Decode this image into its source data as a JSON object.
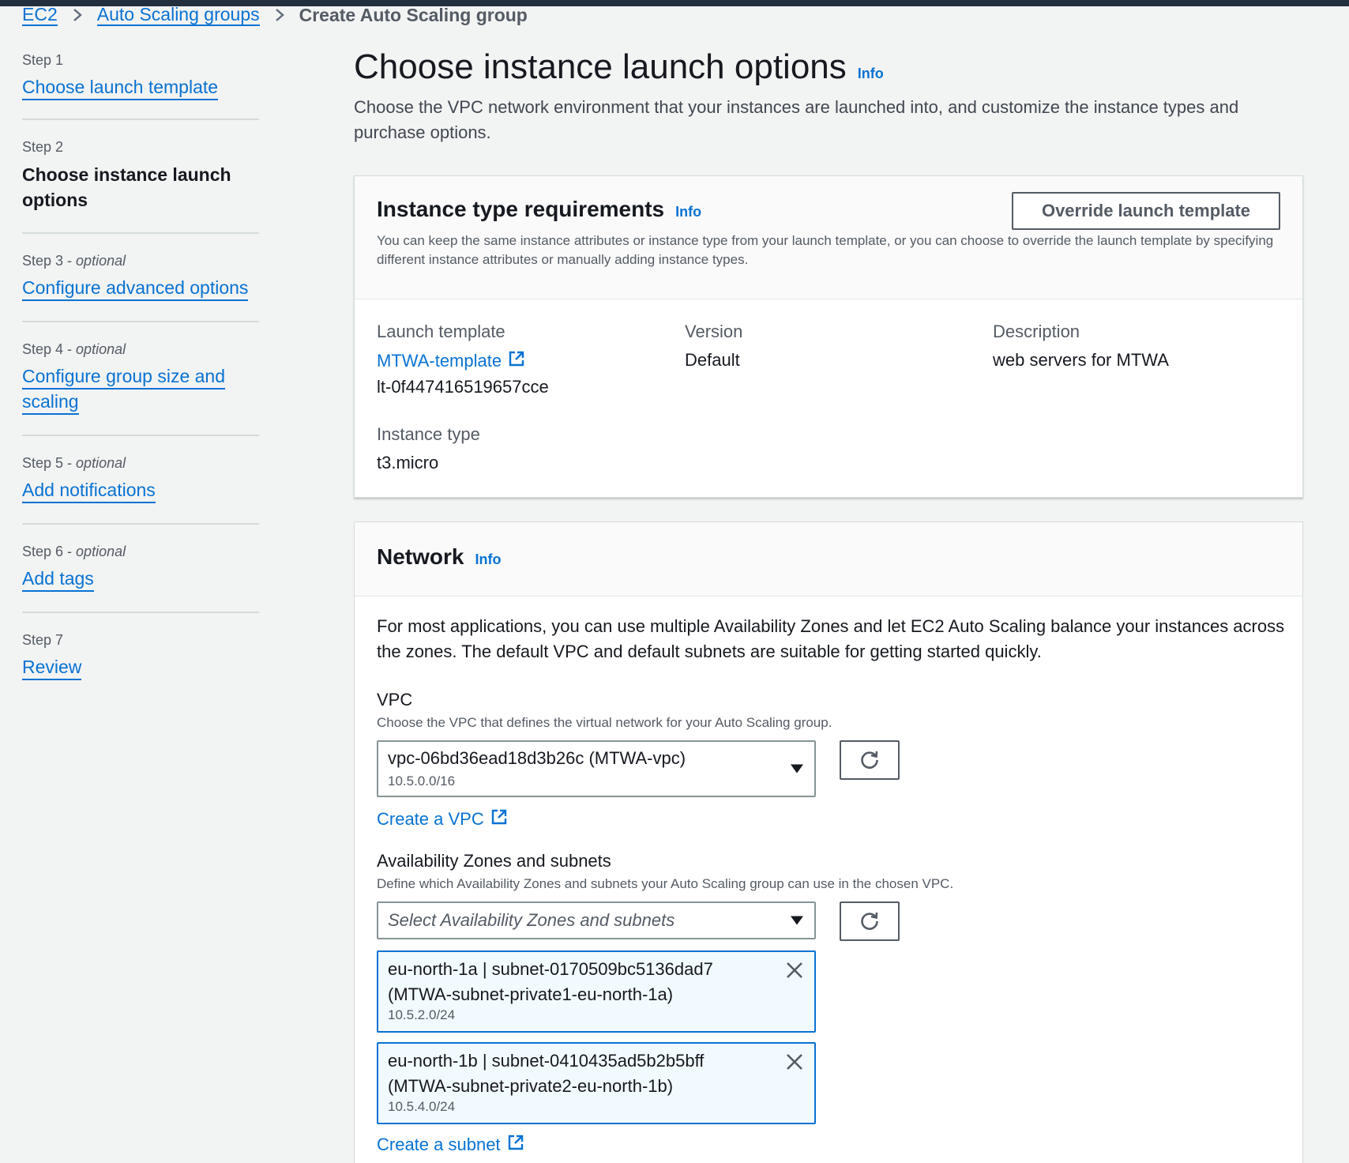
{
  "breadcrumb": {
    "items": [
      "EC2",
      "Auto Scaling groups"
    ],
    "current": "Create Auto Scaling group"
  },
  "steps": [
    {
      "label": "Step 1",
      "optional": "",
      "title": "Choose launch template",
      "current": false
    },
    {
      "label": "Step 2",
      "optional": "",
      "title_line1": "Choose instance launch",
      "title_line2": "options",
      "current": true
    },
    {
      "label": "Step 3 - ",
      "optional": "optional",
      "title": "Configure advanced options",
      "current": false
    },
    {
      "label": "Step 4 - ",
      "optional": "optional",
      "title_line1": "Configure group size and",
      "title_line2": "scaling",
      "current": false
    },
    {
      "label": "Step 5 - ",
      "optional": "optional",
      "title": "Add notifications",
      "current": false
    },
    {
      "label": "Step 6 - ",
      "optional": "optional",
      "title": "Add tags",
      "current": false
    },
    {
      "label": "Step 7",
      "optional": "",
      "title": "Review",
      "current": false
    }
  ],
  "page": {
    "title": "Choose instance launch options",
    "info": "Info",
    "description": "Choose the VPC network environment that your instances are launched into, and customize the instance types and purchase options."
  },
  "instance_panel": {
    "title": "Instance type requirements",
    "info": "Info",
    "override_button": "Override launch template",
    "subtitle": "You can keep the same instance attributes or instance type from your launch template, or you can choose to override the launch template by specifying different instance attributes or manually adding instance types.",
    "launch_template_label": "Launch template",
    "launch_template_link": "MTWA-template",
    "launch_template_id": "lt-0f447416519657cce",
    "version_label": "Version",
    "version_value": "Default",
    "description_label": "Description",
    "description_value": "web servers for MTWA",
    "instance_type_label": "Instance type",
    "instance_type_value": "t3.micro"
  },
  "network_panel": {
    "title": "Network",
    "info": "Info",
    "intro": "For most applications, you can use multiple Availability Zones and let EC2 Auto Scaling balance your instances across the zones. The default VPC and default subnets are suitable for getting started quickly.",
    "vpc_label": "VPC",
    "vpc_desc": "Choose the VPC that defines the virtual network for your Auto Scaling group.",
    "vpc_value": "vpc-06bd36ead18d3b26c (MTWA-vpc)",
    "vpc_cidr": "10.5.0.0/16",
    "create_vpc": "Create a VPC",
    "az_label": "Availability Zones and subnets",
    "az_desc": "Define which Availability Zones and subnets your Auto Scaling group can use in the chosen VPC.",
    "az_placeholder": "Select Availability Zones and subnets",
    "subnets": [
      {
        "line1": "eu-north-1a | subnet-0170509bc5136dad7",
        "line2": "(MTWA-subnet-private1-eu-north-1a)",
        "cidr": "10.5.2.0/24"
      },
      {
        "line1": "eu-north-1b | subnet-0410435ad5b2b5bff",
        "line2": "(MTWA-subnet-private2-eu-north-1b)",
        "cidr": "10.5.4.0/24"
      }
    ],
    "create_subnet": "Create a subnet"
  },
  "colors": {
    "link": "#0972d3",
    "nav_bar": "#232f3e",
    "background": "#f2f3f3",
    "token_bg": "#f1faff"
  },
  "icons": [
    "chevron-right-icon",
    "external-link-icon",
    "caret-down-icon",
    "refresh-icon",
    "close-icon"
  ]
}
